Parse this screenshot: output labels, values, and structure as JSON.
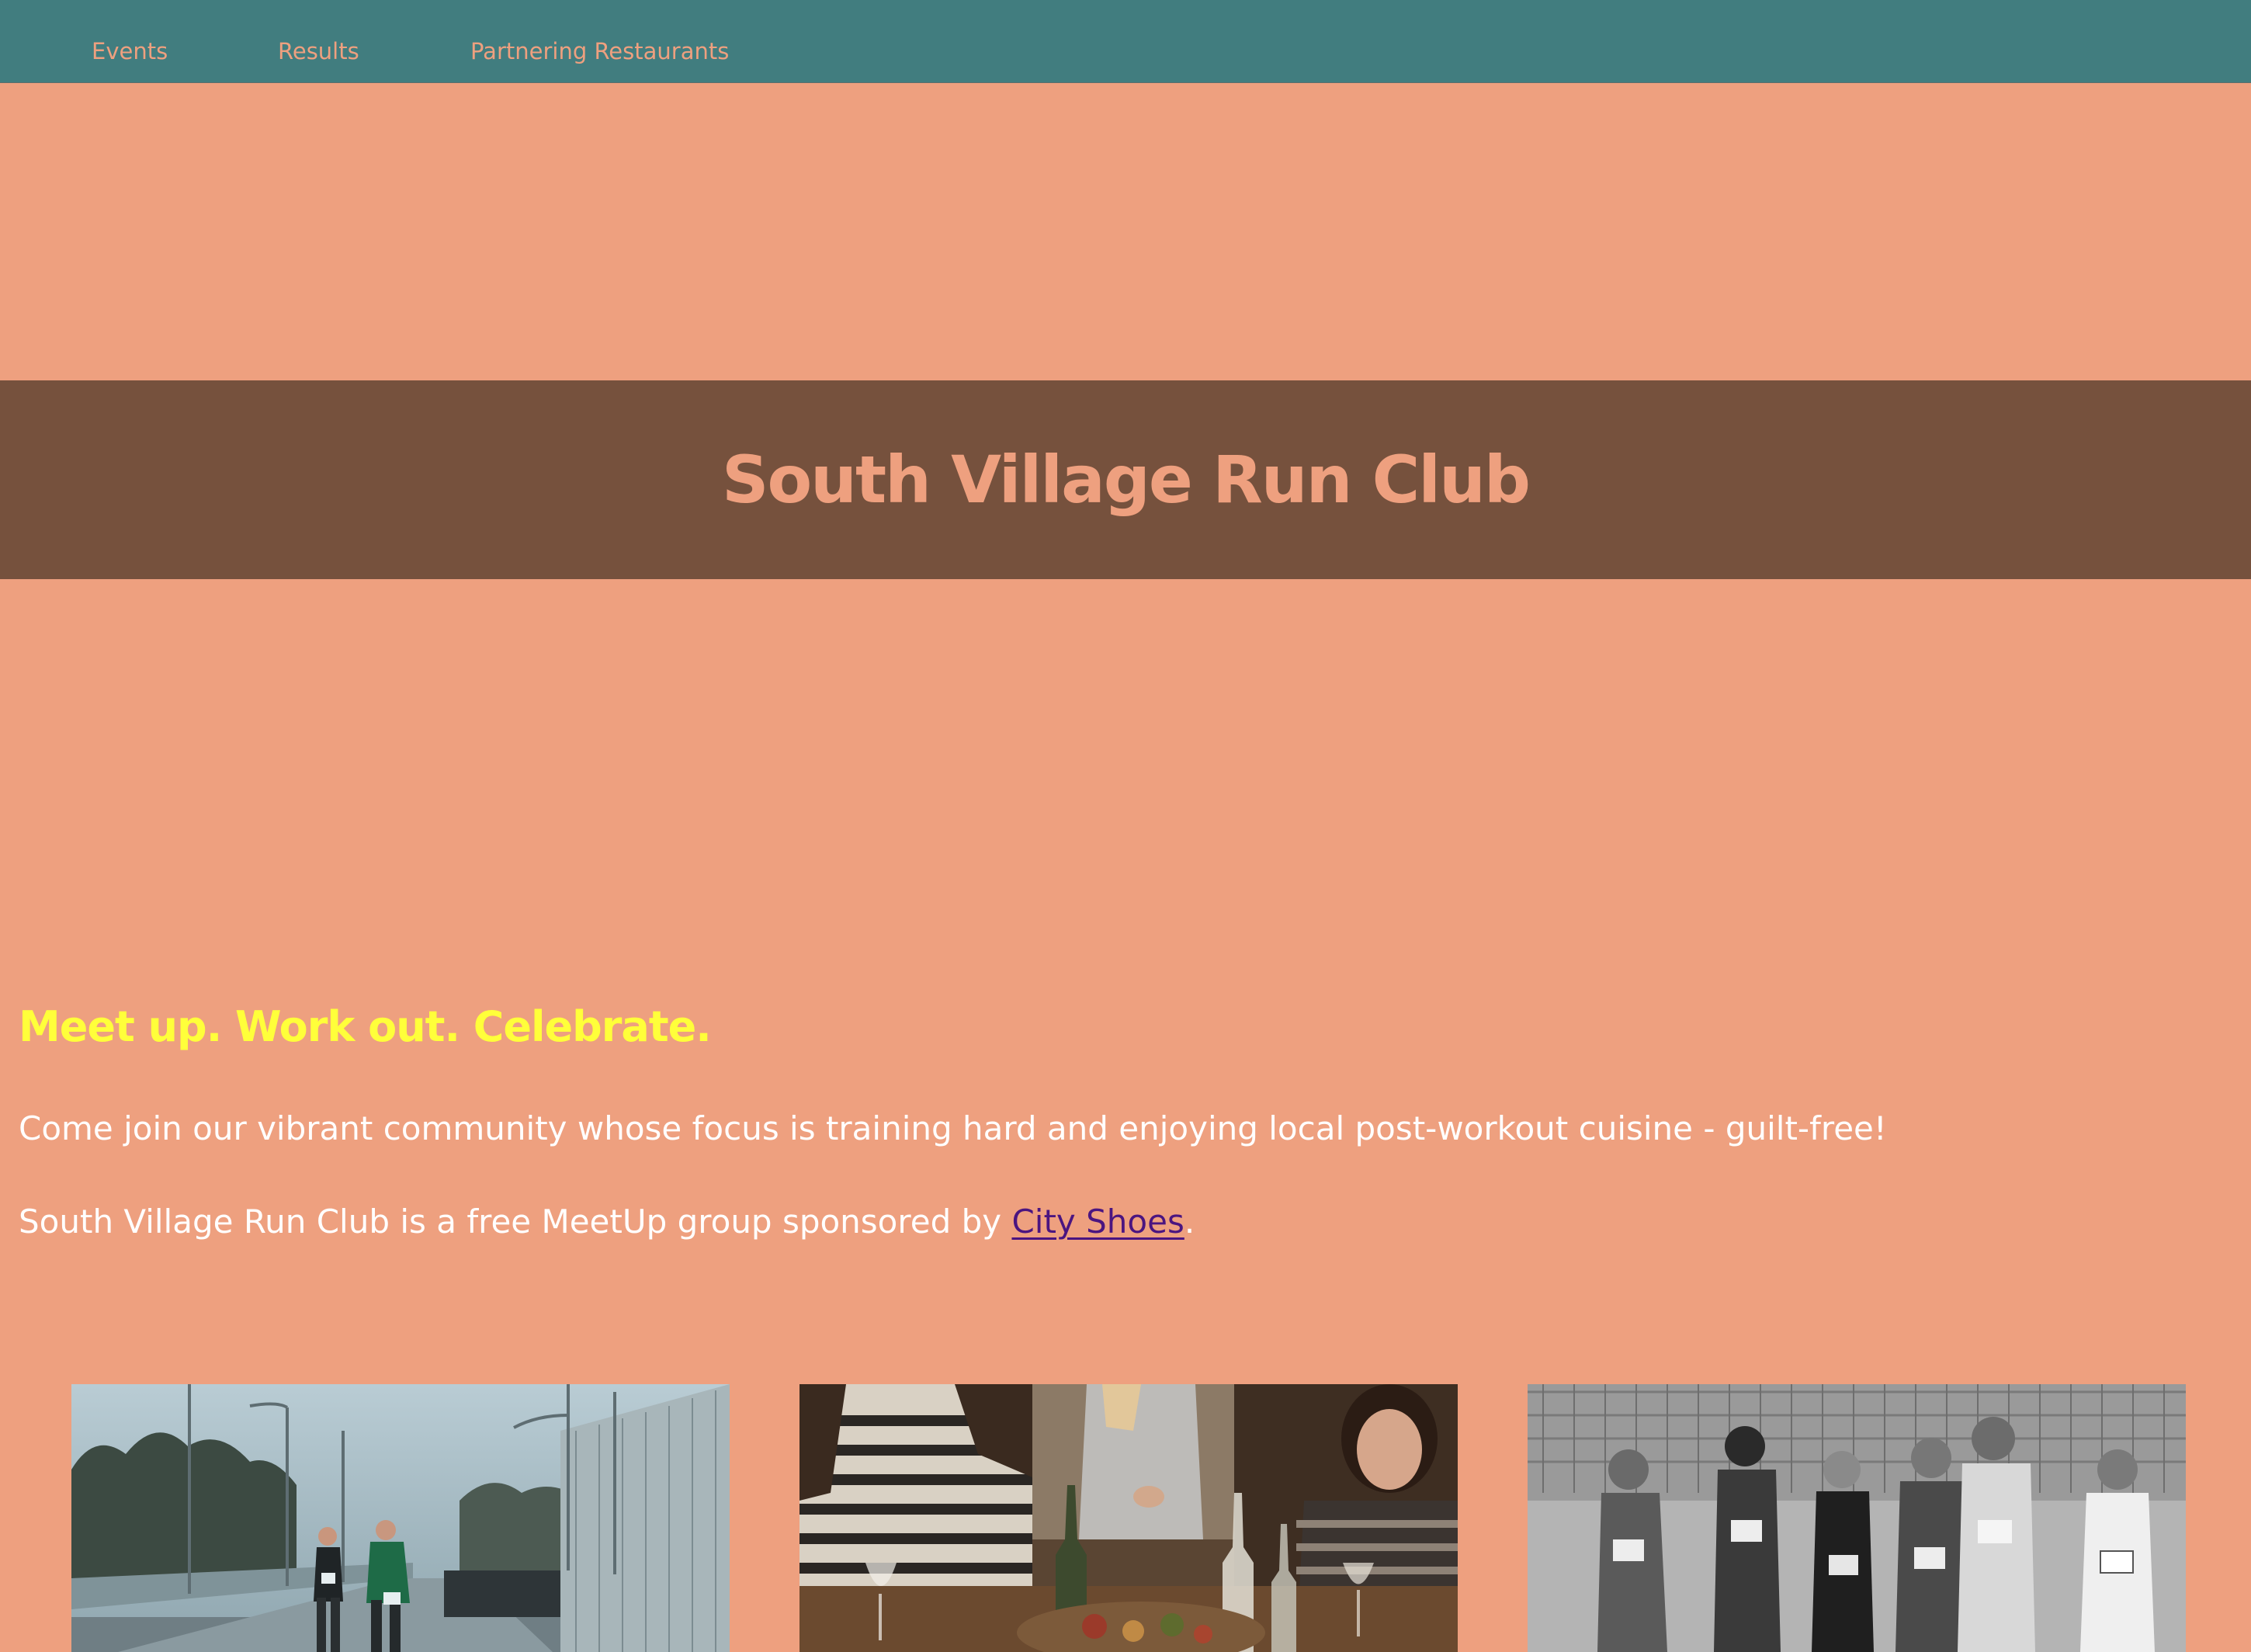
{
  "nav": {
    "items": [
      {
        "label": "Events"
      },
      {
        "label": "Results"
      },
      {
        "label": "Partnering Restaurants"
      }
    ]
  },
  "hero": {
    "title": "South Village Run Club"
  },
  "intro": {
    "tagline": "Meet up. Work out. Celebrate.",
    "paragraph1": "Come join our vibrant community whose focus is training hard and enjoying local post-workout cuisine - guilt-free!",
    "paragraph2_prefix": "South Village Run Club is a free MeetUp group sponsored by ",
    "sponsor_link": "City Shoes",
    "paragraph2_suffix": "."
  },
  "gallery": {
    "images": [
      {
        "subject": "runners-on-overpass-photo"
      },
      {
        "subject": "dinner-party-photo"
      },
      {
        "subject": "marathon-runners-photo"
      }
    ]
  },
  "colors": {
    "page_background": "#EEA07F",
    "nav_background": "#417D7F",
    "nav_text": "#EEA07F",
    "banner_background": "#76513D",
    "banner_text": "#EEA07F",
    "tagline": "#FFFF3A",
    "body_text": "#FFFFFF",
    "link": "#4B1580"
  }
}
